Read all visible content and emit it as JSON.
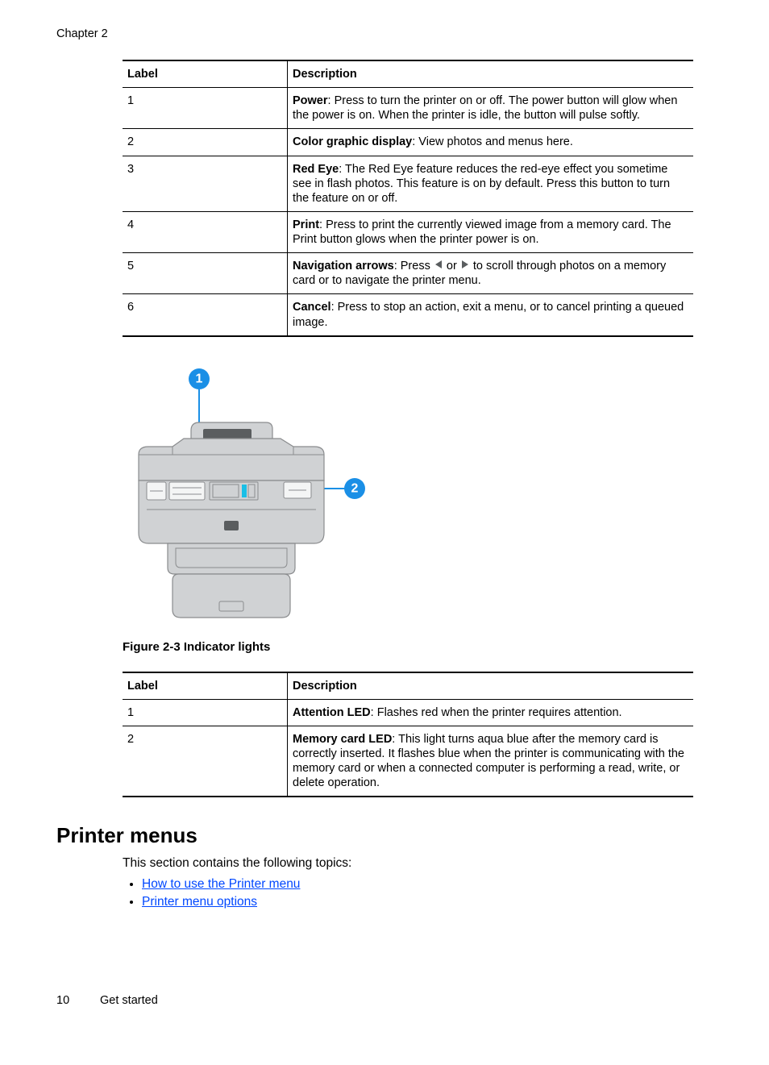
{
  "chapter": "Chapter 2",
  "table1": {
    "headers": {
      "label": "Label",
      "desc": "Description"
    },
    "rows": [
      {
        "label": "1",
        "term": "Power",
        "desc": ": Press to turn the printer on or off. The power button will glow when the power is on. When the printer is idle, the button will pulse softly."
      },
      {
        "label": "2",
        "term": "Color graphic display",
        "desc": ": View photos and menus here."
      },
      {
        "label": "3",
        "term": "Red Eye",
        "desc": ": The Red Eye feature reduces the red-eye effect you sometime see in flash photos. This feature is on by default. Press this button to turn the feature on or off."
      },
      {
        "label": "4",
        "term": "Print",
        "desc": ": Press to print the currently viewed image from a memory card. The Print button glows when the printer power is on."
      },
      {
        "label": "5",
        "term": "Navigation arrows",
        "pre": ": Press ",
        "mid": " or ",
        "post": " to scroll through photos on a memory card or to navigate the printer menu."
      },
      {
        "label": "6",
        "term": "Cancel",
        "desc": ": Press to stop an action, exit a menu, or to cancel printing a queued image."
      }
    ]
  },
  "figure": {
    "caption": "Figure 2-3 Indicator lights"
  },
  "table2": {
    "headers": {
      "label": "Label",
      "desc": "Description"
    },
    "rows": [
      {
        "label": "1",
        "term": "Attention LED",
        "desc": ": Flashes red when the printer requires attention."
      },
      {
        "label": "2",
        "term": "Memory card LED",
        "desc": ": This light turns aqua blue after the memory card is correctly inserted. It flashes blue when the printer is communicating with the memory card or when a connected computer is performing a read, write, or delete operation."
      }
    ]
  },
  "section": {
    "heading": "Printer menus",
    "intro": "This section contains the following topics:",
    "links": [
      "How to use the Printer menu",
      "Printer menu options"
    ]
  },
  "footer": {
    "page": "10",
    "title": "Get started"
  }
}
